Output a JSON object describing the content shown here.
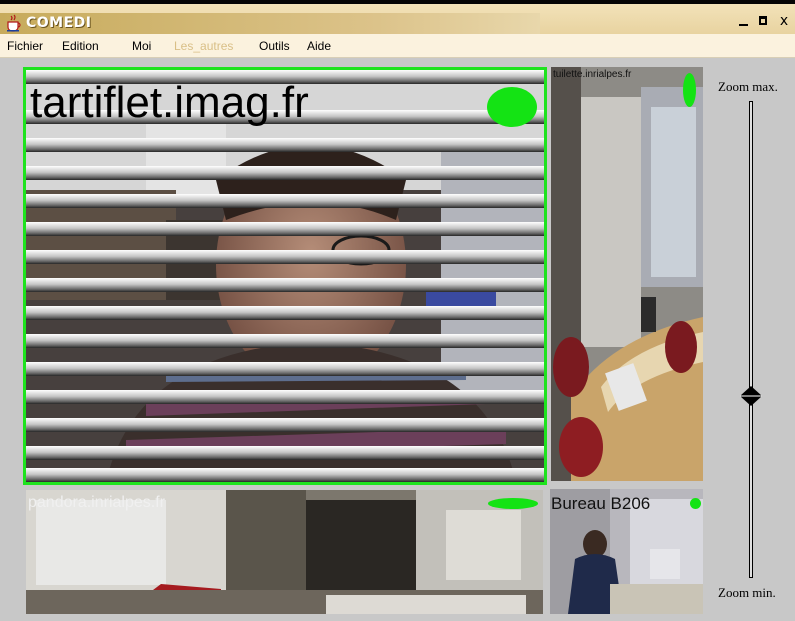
{
  "window": {
    "title": "COMEDI",
    "minimize": "_",
    "maximize": "□",
    "close": "x"
  },
  "menu": [
    "Fichier",
    "Edition",
    "Moi",
    "Les_autres",
    "Outils",
    "Aide"
  ],
  "menu_disabled": [
    "Les_autres"
  ],
  "videos": {
    "main": {
      "label": "tartiflet.imag.fr",
      "status_color": "#14e314"
    },
    "top_right": {
      "label": "tuilette.inrialpes.fr",
      "status_color": "#14e314"
    },
    "bottom_left": {
      "label": "pandora.inrialpes.fr",
      "status_color": "#14e314"
    },
    "bottom_right": {
      "label": "Bureau B206",
      "status_color": "#14e314"
    }
  },
  "zoom": {
    "max_label": "Zoom max.",
    "min_label": "Zoom min.",
    "level": 0.39
  },
  "colors": {
    "title_bar": "#c7ab5c",
    "menu_bar": "#fbf2de",
    "active_border": "#1ee31e",
    "disabled_menu": "#d9bf86"
  }
}
